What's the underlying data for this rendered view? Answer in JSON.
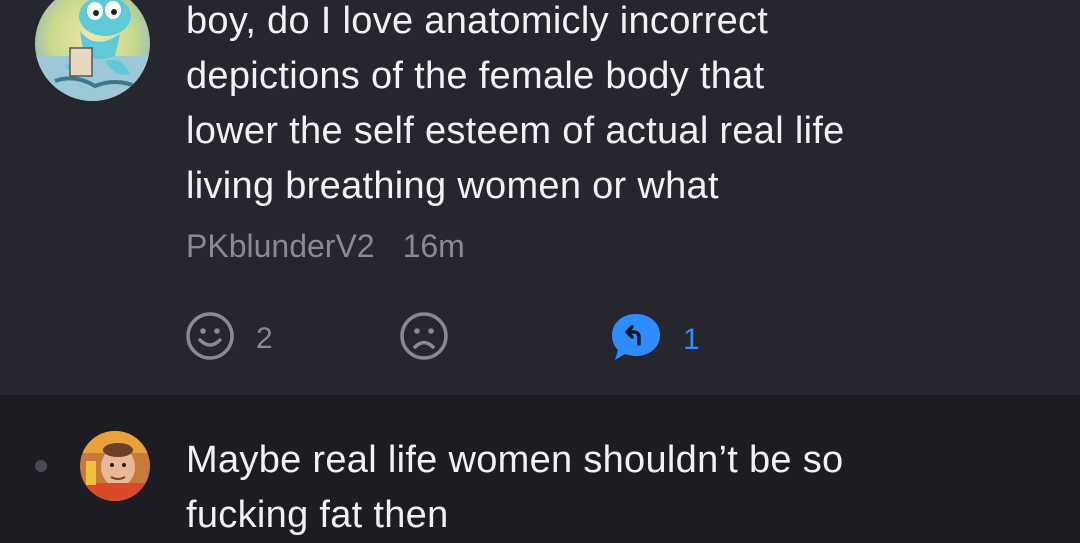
{
  "comments": [
    {
      "text": "boy, do I love anatomicly incorrect\ndepictions of the female body that\nlower the self esteem of actual real life\nliving breathing women or what",
      "username": "PKblunderV2",
      "time": "16m",
      "avatar_icon": "cartoon-avatar-icon",
      "actions": {
        "upvote_icon": "smiley-face-icon",
        "upvote_count": "2",
        "downvote_icon": "frowny-face-icon",
        "reply_icon": "reply-bubble-icon",
        "reply_count": "1"
      }
    },
    {
      "text": "Maybe real life women shouldn’t be so\nfucking fat then",
      "avatar_icon": "photo-avatar-icon"
    }
  ],
  "colors": {
    "accent": "#2f8cff",
    "muted": "#8a8a94",
    "text": "#f2f2f4"
  }
}
